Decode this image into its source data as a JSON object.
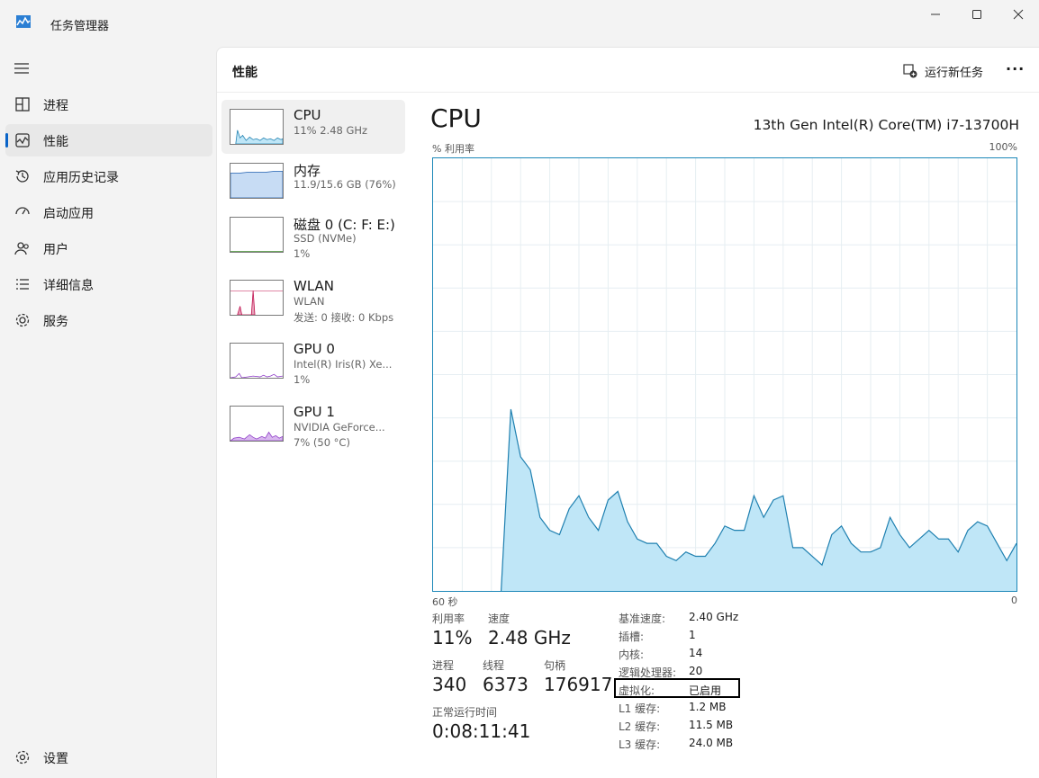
{
  "window": {
    "title": "任务管理器"
  },
  "nav": {
    "items": [
      {
        "label": "进程",
        "icon": "processes-icon"
      },
      {
        "label": "性能",
        "icon": "performance-icon"
      },
      {
        "label": "应用历史记录",
        "icon": "app-history-icon"
      },
      {
        "label": "启动应用",
        "icon": "startup-apps-icon"
      },
      {
        "label": "用户",
        "icon": "users-icon"
      },
      {
        "label": "详细信息",
        "icon": "details-icon"
      },
      {
        "label": "服务",
        "icon": "services-icon"
      }
    ],
    "active_index": 1,
    "settings_label": "设置"
  },
  "header": {
    "title": "性能",
    "run_task_label": "运行新任务",
    "more_label": "···"
  },
  "devices": [
    {
      "name": "CPU",
      "sub": "11%  2.48 GHz",
      "sub2": ""
    },
    {
      "name": "内存",
      "sub": "11.9/15.6 GB (76%)",
      "sub2": ""
    },
    {
      "name": "磁盘 0 (C: F: E:)",
      "sub": "SSD (NVMe)",
      "sub2": "1%"
    },
    {
      "name": "WLAN",
      "sub": "WLAN",
      "sub2": "发送: 0 接收: 0 Kbps"
    },
    {
      "name": "GPU 0",
      "sub": "Intel(R) Iris(R) Xe...",
      "sub2": "1%"
    },
    {
      "name": "GPU 1",
      "sub": "NVIDIA GeForce...",
      "sub2": "7% (50 °C)"
    }
  ],
  "detail": {
    "title": "CPU",
    "model": "13th Gen Intel(R) Core(TM) i7-13700H",
    "axis_top_left": "% 利用率",
    "axis_top_right": "100%",
    "axis_bottom_left": "60 秒",
    "axis_bottom_right": "0",
    "stats": {
      "util_label": "利用率",
      "util_value": "11%",
      "speed_label": "速度",
      "speed_value": "2.48 GHz",
      "proc_label": "进程",
      "proc_value": "340",
      "threads_label": "线程",
      "threads_value": "6373",
      "handles_label": "句柄",
      "handles_value": "176917",
      "uptime_label": "正常运行时间",
      "uptime_value": "0:08:11:41"
    },
    "specs": [
      {
        "k": "基准速度:",
        "v": "2.40 GHz"
      },
      {
        "k": "插槽:",
        "v": "1"
      },
      {
        "k": "内核:",
        "v": "14"
      },
      {
        "k": "逻辑处理器:",
        "v": "20"
      },
      {
        "k": "虚拟化:",
        "v": "已启用"
      },
      {
        "k": "L1 缓存:",
        "v": "1.2 MB"
      },
      {
        "k": "L2 缓存:",
        "v": "11.5 MB"
      },
      {
        "k": "L3 缓存:",
        "v": "24.0 MB"
      }
    ]
  },
  "colors": {
    "cpu_line": "#1f80b0",
    "cpu_fill": "#bfe6f7",
    "mem_fill": "#c7dcf4",
    "wlan": "#c0104e",
    "gpu": "#8e3cc8"
  },
  "chart_data": {
    "type": "area",
    "xlabel": "60 秒",
    "ylabel": "% 利用率",
    "x": [
      60,
      59,
      58,
      57,
      56,
      55,
      54,
      53,
      52,
      51,
      50,
      49,
      48,
      47,
      46,
      45,
      44,
      43,
      42,
      41,
      40,
      39,
      38,
      37,
      36,
      35,
      34,
      33,
      32,
      31,
      30,
      29,
      28,
      27,
      26,
      25,
      24,
      23,
      22,
      21,
      20,
      19,
      18,
      17,
      16,
      15,
      14,
      13,
      12,
      11,
      10,
      9,
      8,
      7,
      6,
      5,
      4,
      3,
      2,
      1,
      0
    ],
    "ylim": [
      0,
      100
    ],
    "xlim": [
      60,
      0
    ],
    "grid": true,
    "series": [
      {
        "values": [
          null,
          null,
          null,
          null,
          null,
          null,
          null,
          0,
          42,
          31,
          28,
          17,
          14,
          13,
          19,
          22,
          17,
          14,
          21,
          23,
          16,
          12,
          11,
          11,
          8,
          7,
          9,
          8,
          8,
          11,
          15,
          14,
          14,
          22,
          17,
          21,
          22,
          10,
          10,
          8,
          6,
          13,
          15,
          11,
          9,
          9,
          10,
          17,
          13,
          10,
          12,
          14,
          12,
          12,
          9,
          14,
          16,
          15,
          11,
          7,
          11
        ]
      }
    ]
  }
}
